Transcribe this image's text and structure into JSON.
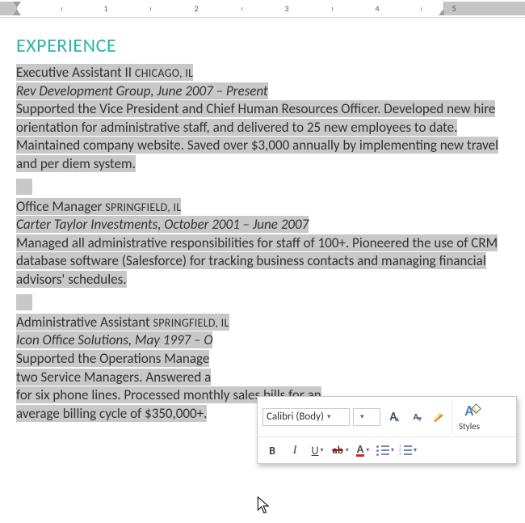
{
  "ruler": {
    "labels": [
      "1",
      "2",
      "3",
      "4",
      "5"
    ]
  },
  "heading": "EXPERIENCE",
  "jobs": [
    {
      "title": "Executive Assistant II",
      "location": "CHICAGO, IL",
      "company": "Rev Development Group, June 2007 – Present",
      "body": "Supported the Vice President and Chief Human Resources Officer. Developed new hire orientation for administrative staff, and delivered to 25 new employees to date. Maintained company website. Saved over $3,000 annually by implementing new travel and per diem system."
    },
    {
      "title": "Office Manager",
      "location": "SPRINGFIELD, IL",
      "company": "Carter Taylor Investments, October 2001 – June 2007",
      "body": "Managed all administrative responsibilities for staff of 100+. Pioneered the use of CRM database software (Salesforce) for tracking business contacts and managing financial advisors' schedules."
    },
    {
      "title": "Administrative Assistant",
      "location": "SPRINGFIELD, IL",
      "company": "Icon Office Solutions, May 1997 – O",
      "body_a": "Supported the Operations Manage",
      "body_b": "two Service Managers. Answered a",
      "body_c": "for six phone lines. Processed mont",
      "body_d": "average billing cycle of $350,000+.",
      "hidden_c_tail": "hly sales bills for an"
    }
  ],
  "toolbar": {
    "font_name": "Calibri (Body)",
    "font_size": "",
    "styles_label": "Styles",
    "bold": "B",
    "italic": "I",
    "underline": "U",
    "grow_font": "A",
    "shrink_font": "A",
    "highlight_glyph": "ab",
    "font_color_glyph": "A"
  }
}
